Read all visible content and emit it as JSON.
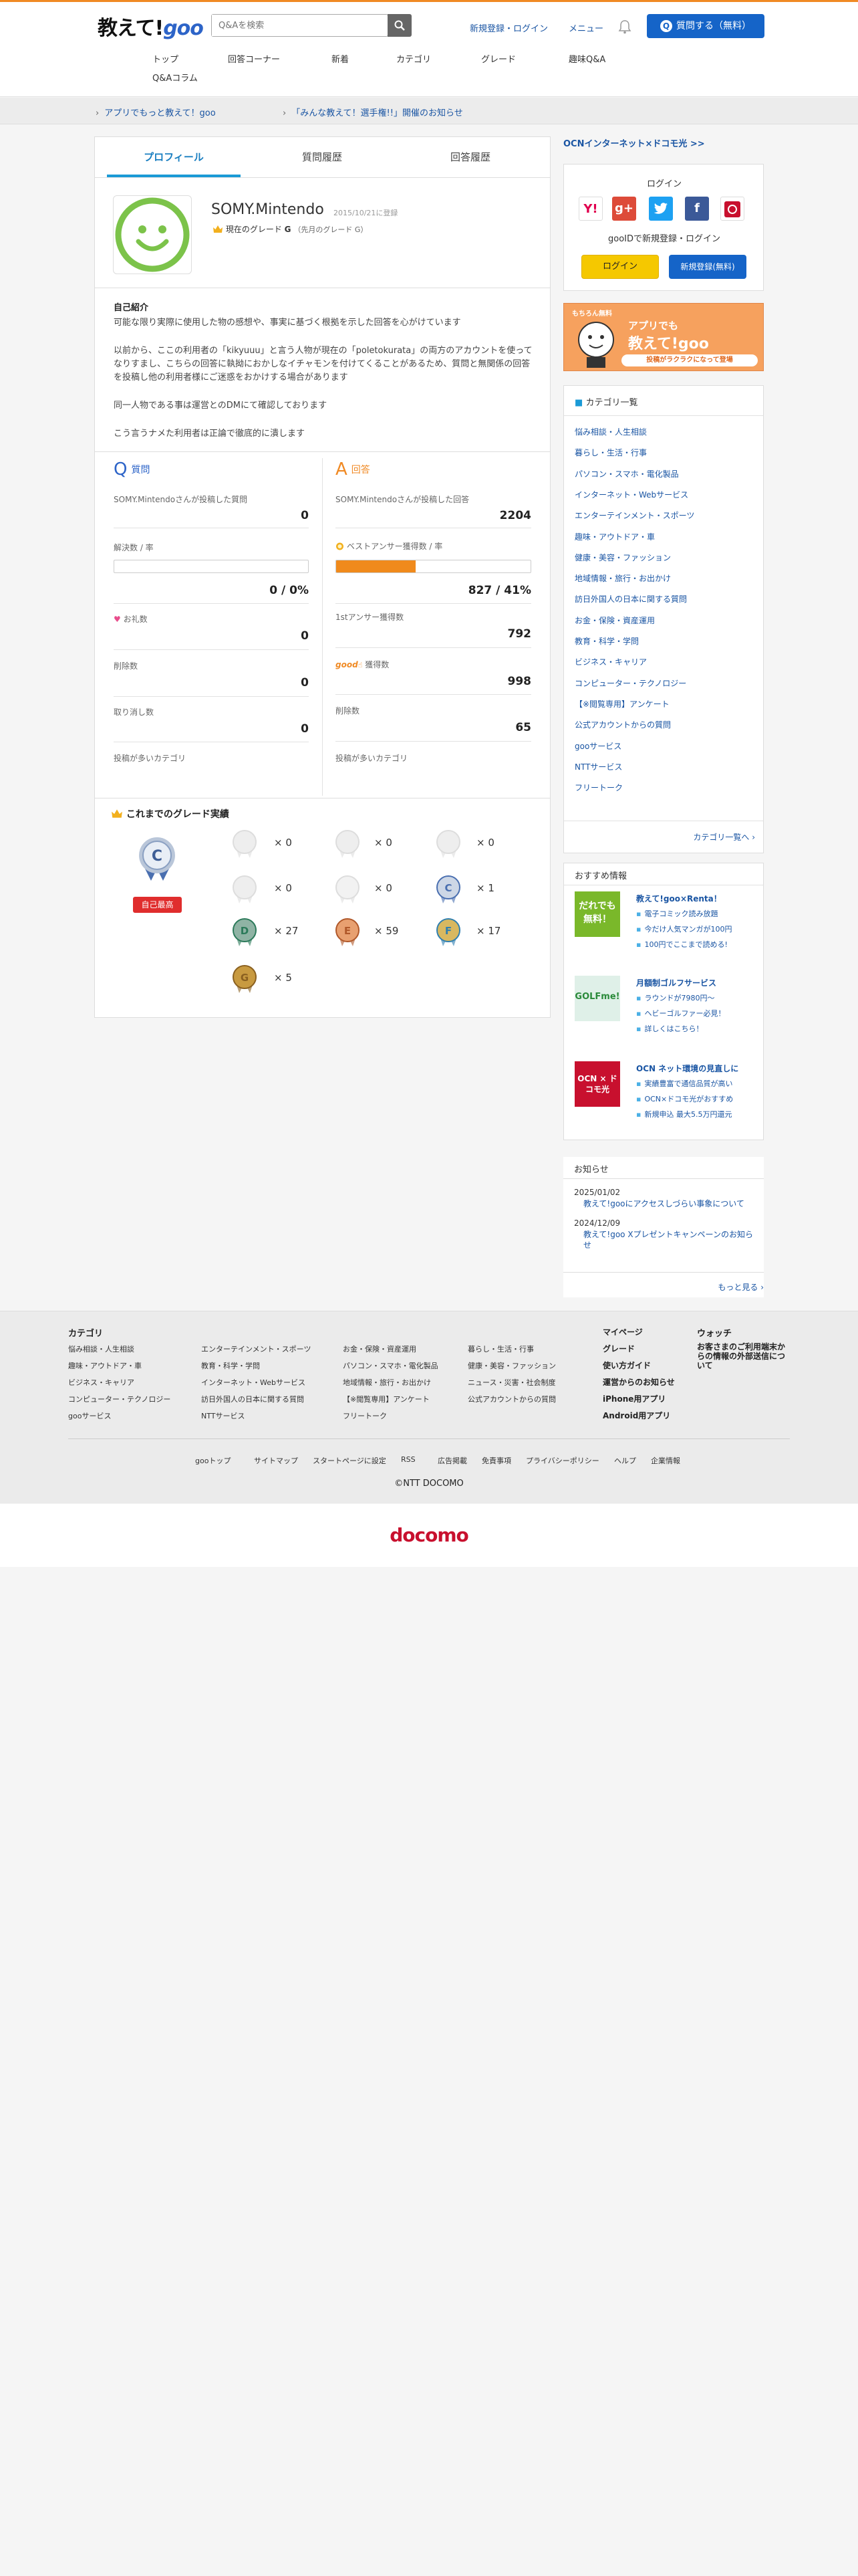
{
  "header": {
    "logo_main": "教えて!",
    "logo_goo": "goo",
    "search_placeholder": "Q&Aを検索",
    "links": [
      "新規登録・ログイン",
      "メニュー"
    ],
    "ask_button": "質問する（無料）",
    "ask_icon": "Q",
    "nav": [
      "トップ",
      "回答コーナー",
      "新着",
      "カテゴリ",
      "グレード",
      "趣味Q&A",
      "Q&Aコラム"
    ]
  },
  "notices": [
    "アプリでもっと教えて！goo",
    "「みんな教えて！選手権!!」開催のお知らせ"
  ],
  "profile": {
    "tabs": [
      "プロフィール",
      "質問履歴",
      "回答履歴"
    ],
    "username": "SOMY.Mintendo",
    "registered": "2015/10/21に登録",
    "grade_label": "現在のグレード",
    "grade_value": "G",
    "grade_prev": "（先月のグレード G）",
    "intro_heading": "自己紹介",
    "intro_lines": [
      "可能な限り実際に使用した物の感想や、事実に基づく根拠を示した回答を心がけています",
      "以前から、ここの利用者の「kikyuuu」と言う人物が現在の「poletokurata」の両方のアカウントを使ってなりすまし、こちらの回答に執拗におかしなイチャモンを付けてくることがあるため、質問と無関係の回答を投稿し他の利用者様にご迷惑をおかけする場合があります",
      "同一人物である事は運営とのDMにて確認しております",
      "こう言うナメた利用者は正論で徹底的に潰します"
    ]
  },
  "questions": {
    "letter": "Q",
    "title": "質問",
    "posted_label": "SOMY.Mintendoさんが投稿した質問",
    "posted_value": "0",
    "resolved_label": "解決数 / 率",
    "resolved_value": "0 / 0%",
    "resolved_rate": 0,
    "thanks_label": "お礼数",
    "thanks_value": "0",
    "deleted_label": "削除数",
    "deleted_value": "0",
    "withdrawn_label": "取り消し数",
    "withdrawn_value": "0",
    "cat_label": "投稿が多いカテゴリ"
  },
  "answers": {
    "letter": "A",
    "title": "回答",
    "posted_label": "SOMY.Mintendoさんが投稿した回答",
    "posted_value": "2204",
    "best_label": "ベストアンサー獲得数 / 率",
    "best_value": "827 / 41%",
    "best_rate": 41,
    "first_label": "1stアンサー獲得数",
    "first_value": "792",
    "good_word": "good",
    "good_label": "獲得数",
    "good_value": "998",
    "deleted_label": "削除数",
    "deleted_value": "65",
    "cat_label": "投稿が多いカテゴリ"
  },
  "grades": {
    "heading": "これまでのグレード実績",
    "best_grade": "C",
    "self_best": "自己最高",
    "counts": [
      "× 0",
      "× 0",
      "× 0",
      "× 0",
      "× 0",
      "× 1",
      "× 27",
      "× 59",
      "× 17",
      "× 5"
    ]
  },
  "sidebar": {
    "ad_link": "OCNインターネット×ドコモ光 >>",
    "login_title": "ログイン",
    "login_sub": "gooIDで新規登録・ログイン",
    "login_button": "ログイン",
    "signup_button": "新規登録(無料)",
    "app_banner": {
      "line1": "もちろん無料",
      "line2": "アプリでも",
      "line3": "教えて!goo",
      "line4": "投稿がラクラクになって登場"
    },
    "cat_title": "カテゴリ一覧",
    "categories": [
      "悩み相談・人生相談",
      "暮らし・生活・行事",
      "パソコン・スマホ・電化製品",
      "インターネット・Webサービス",
      "エンターテインメント・スポーツ",
      "趣味・アウトドア・車",
      "健康・美容・ファッション",
      "地域情報・旅行・お出かけ",
      "訪日外国人の日本に関する質問",
      "お金・保険・資産運用",
      "教育・科学・学問",
      "ビジネス・キャリア",
      "コンピューター・テクノロジー",
      "【※閲覧専用】アンケート",
      "公式アカウントからの質問",
      "gooサービス",
      "NTTサービス",
      "フリートーク"
    ],
    "cat_more": "カテゴリ一覧へ",
    "rec_title": "おすすめ情報",
    "recs": [
      {
        "img": "だれでも無料！",
        "title": "教えて!goo×Renta！",
        "items": [
          "電子コミック読み放題",
          "今だけ人気マンガが100円",
          "100円でここまで読める!"
        ]
      },
      {
        "img": "GOLFme!",
        "title": "月額制ゴルフサービス",
        "items": [
          "ラウンドが7980円〜",
          "ヘビーゴルファー必見！",
          "詳しくはこちら！"
        ]
      },
      {
        "img": "OCN × ドコモ光",
        "title": "OCN ネット環境の見直しに",
        "items": [
          "実績豊富で通信品質が高い",
          "OCN×ドコモ光がおすすめ",
          "新規申込 最大5.5万円還元"
        ]
      }
    ],
    "news_title": "お知らせ",
    "news": [
      {
        "date": "2025/01/02",
        "text": "教えて!gooにアクセスしづらい事象について"
      },
      {
        "date": "2024/12/09",
        "text": "教えて!goo Xプレゼントキャンペーンのお知らせ"
      }
    ],
    "news_more": "もっと見る"
  },
  "footer": {
    "cat_heading": "カテゴリ",
    "col1": [
      "悩み相談・人生相談",
      "趣味・アウトドア・車",
      "ビジネス・キャリア",
      "コンピューター・テクノロジー",
      "gooサービス"
    ],
    "col2": [
      "エンターテインメント・スポーツ",
      "教育・科学・学問",
      "インターネット・Webサービス",
      "訪日外国人の日本に関する質問",
      "NTTサービス"
    ],
    "col3": [
      "お金・保険・資産運用",
      "パソコン・スマホ・電化製品",
      "地域情報・旅行・お出かけ",
      "【※閲覧専用】アンケート",
      "フリートーク"
    ],
    "col4": [
      "暮らし・生活・行事",
      "健康・美容・ファッション",
      "ニュース・災害・社会制度",
      "公式アカウントからの質問"
    ],
    "col5": [
      "マイページ",
      "グレード",
      "使い方ガイド",
      "運営からのお知らせ",
      "iPhone用アプリ",
      "Android用アプリ"
    ],
    "watch_heading": "ウォッチ",
    "watch_text": "お客さまのご利用端末からの情報の外部送信について",
    "bottom_links": [
      "gooトップ",
      "サイトマップ",
      "スタートページに設定",
      "RSS",
      "広告掲載",
      "免責事項",
      "プライバシーポリシー",
      "ヘルプ",
      "企業情報"
    ],
    "copyright": "©NTT DOCOMO",
    "docomo": "docomo"
  },
  "colors": {
    "accent": "#1a9ad6",
    "brand_orange": "#f08a24",
    "brand_blue": "#1564c8",
    "badge_red": "#e02d2d"
  }
}
